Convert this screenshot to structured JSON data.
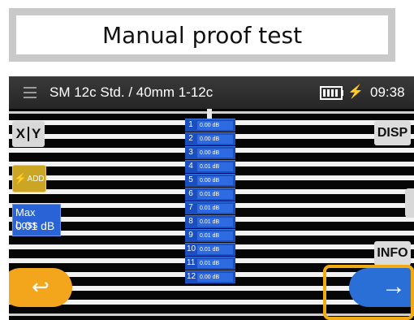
{
  "caption": {
    "title": "Manual proof test"
  },
  "header": {
    "menu_icon": "hamburger-menu-icon",
    "title": "SM 12c Std. / 40mm 1-12c",
    "battery_icon": "battery-full-icon",
    "power_icon": "power-plug-icon",
    "power_glyph": "⚡",
    "time": "09:38"
  },
  "screen": {
    "xy_button": {
      "x": "X",
      "y": "Y"
    },
    "add_button": {
      "label": "ADD",
      "icon": "lightning-icon"
    },
    "max_loss": {
      "label": "Max Loss",
      "value": "0.01 dB"
    },
    "disp_button": "DISP",
    "info_button": "INFO",
    "back_button": {
      "icon": "return-arrow-icon",
      "glyph": "↩"
    },
    "next_button": {
      "icon": "right-arrow-icon",
      "glyph": "→"
    },
    "fiber_losses": [
      {
        "num": "1",
        "value": "0.00 dB"
      },
      {
        "num": "2",
        "value": "0.00 dB"
      },
      {
        "num": "3",
        "value": "0.00 dB"
      },
      {
        "num": "4",
        "value": "0.01 dB"
      },
      {
        "num": "5",
        "value": "0.00 dB"
      },
      {
        "num": "6",
        "value": "0.01 dB"
      },
      {
        "num": "7",
        "value": "0.01 dB"
      },
      {
        "num": "8",
        "value": "0.01 dB"
      },
      {
        "num": "9",
        "value": "0.01 dB"
      },
      {
        "num": "10",
        "value": "0.01 dB"
      },
      {
        "num": "11",
        "value": "0.01 dB"
      },
      {
        "num": "12",
        "value": "0.00 dB"
      }
    ]
  },
  "colors": {
    "accent_blue": "#2a6fd6",
    "accent_orange": "#f3a51b",
    "highlight": "#f0aa12"
  }
}
